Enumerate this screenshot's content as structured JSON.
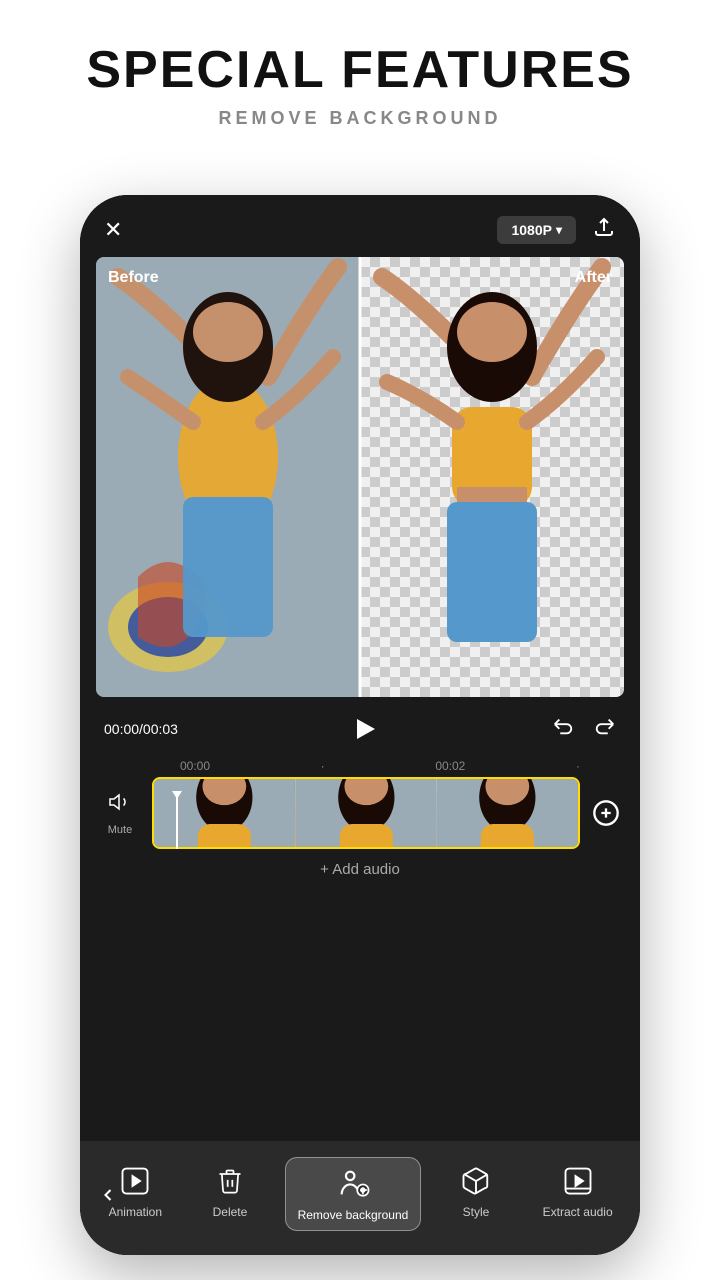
{
  "header": {
    "title": "SPECIAL FEATURES",
    "subtitle": "REMOVE BACKGROUND"
  },
  "phone": {
    "topbar": {
      "quality": "1080P",
      "close_label": "✕"
    },
    "preview": {
      "before_label": "Before",
      "after_label": "After"
    },
    "playback": {
      "time_current": "00:00",
      "time_total": "00:03",
      "time_display": "00:00/00:03"
    },
    "timeline": {
      "ruler_marks": [
        "00:00",
        "00:02"
      ],
      "mute_label": "Mute"
    },
    "add_audio_label": "+ Add audio",
    "toolbar": {
      "back_label": "<",
      "items": [
        {
          "id": "animation",
          "label": "Animation",
          "icon": "play-square-icon"
        },
        {
          "id": "delete",
          "label": "Delete",
          "icon": "trash-icon"
        },
        {
          "id": "remove-background",
          "label": "Remove background",
          "icon": "remove-bg-icon",
          "active": true
        },
        {
          "id": "style",
          "label": "Style",
          "icon": "cube-icon"
        },
        {
          "id": "extract-audio",
          "label": "Extract audio",
          "icon": "film-play-icon"
        }
      ]
    }
  }
}
